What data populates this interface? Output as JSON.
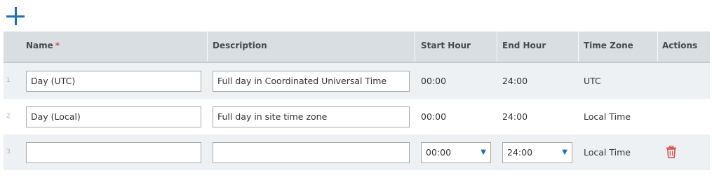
{
  "colors": {
    "accent": "#1f6fb2",
    "required": "#d9534f",
    "delete": "#d9534f",
    "header_bg": "#d9dee2",
    "row_shaded": "#eef1f3"
  },
  "toolbar": {
    "add_icon": "plus-icon"
  },
  "columns": {
    "name": "Name",
    "required_mark": "*",
    "description": "Description",
    "start_hour": "Start Hour",
    "end_hour": "End Hour",
    "time_zone": "Time Zone",
    "actions": "Actions"
  },
  "rows": [
    {
      "num": "1",
      "name": "Day (UTC)",
      "description": "Full day in Coordinated Universal Time",
      "start": "00:00",
      "end": "24:00",
      "tz": "UTC"
    },
    {
      "num": "2",
      "name": "Day (Local)",
      "description": "Full day in site time zone",
      "start": "00:00",
      "end": "24:00",
      "tz": "Local Time"
    },
    {
      "num": "3",
      "name": "",
      "description": "",
      "start": "00:00",
      "end": "24:00",
      "tz": "Local Time",
      "delete_icon": "trash-icon"
    }
  ]
}
